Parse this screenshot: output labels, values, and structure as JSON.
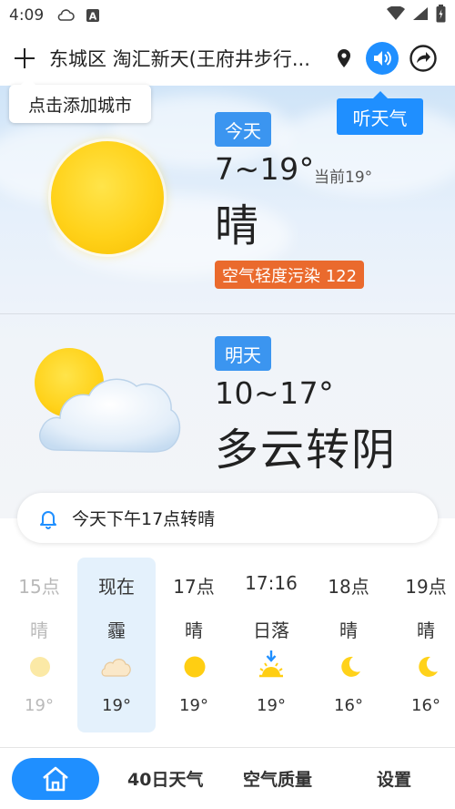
{
  "status_bar": {
    "time": "4:09",
    "icons": [
      "cloud-outline-icon",
      "a-box-icon",
      "wifi-icon",
      "signal-icon",
      "battery-icon"
    ]
  },
  "top_bar": {
    "add_icon": "plus-icon",
    "location": "东城区 淘汇新天(王府井步行...",
    "pin_icon": "location-pin-icon",
    "speaker_icon": "speaker-icon",
    "share_icon": "share-icon"
  },
  "tooltips": {
    "add_city": "点击添加城市",
    "listen_weather": "听天气"
  },
  "today": {
    "label": "今天",
    "temp_range": "7~19°",
    "current": "当前19°",
    "condition": "晴",
    "aqi": "空气轻度污染 122",
    "icon": "sun-icon"
  },
  "tomorrow": {
    "label": "明天",
    "temp_range": "10~17°",
    "condition": "多云转阴",
    "icon": "partly-cloudy-icon"
  },
  "notice": {
    "icon": "bell-icon",
    "text": "今天下午17点转晴"
  },
  "hourly": [
    {
      "time": "15点",
      "cond": "晴",
      "icon": "sun-icon",
      "temp": "19°",
      "state": "past"
    },
    {
      "time": "现在",
      "cond": "霾",
      "icon": "haze-cloud-icon",
      "temp": "19°",
      "state": "now"
    },
    {
      "time": "17点",
      "cond": "晴",
      "icon": "sun-icon",
      "temp": "19°",
      "state": "future"
    },
    {
      "time": "17:16",
      "cond": "日落",
      "icon": "sunset-icon",
      "temp": "19°",
      "state": "future"
    },
    {
      "time": "18点",
      "cond": "晴",
      "icon": "moon-icon",
      "temp": "16°",
      "state": "future"
    },
    {
      "time": "19点",
      "cond": "晴",
      "icon": "moon-icon",
      "temp": "16°",
      "state": "future"
    }
  ],
  "bottom_nav": {
    "home_icon": "home-icon",
    "items": [
      "40日天气",
      "空气质量",
      "设置"
    ]
  },
  "colors": {
    "accent": "#1f8fff",
    "badge_blue": "#3b95f0",
    "aqi_orange": "#ea6a2d",
    "sun_yellow": "#ffd21a"
  }
}
